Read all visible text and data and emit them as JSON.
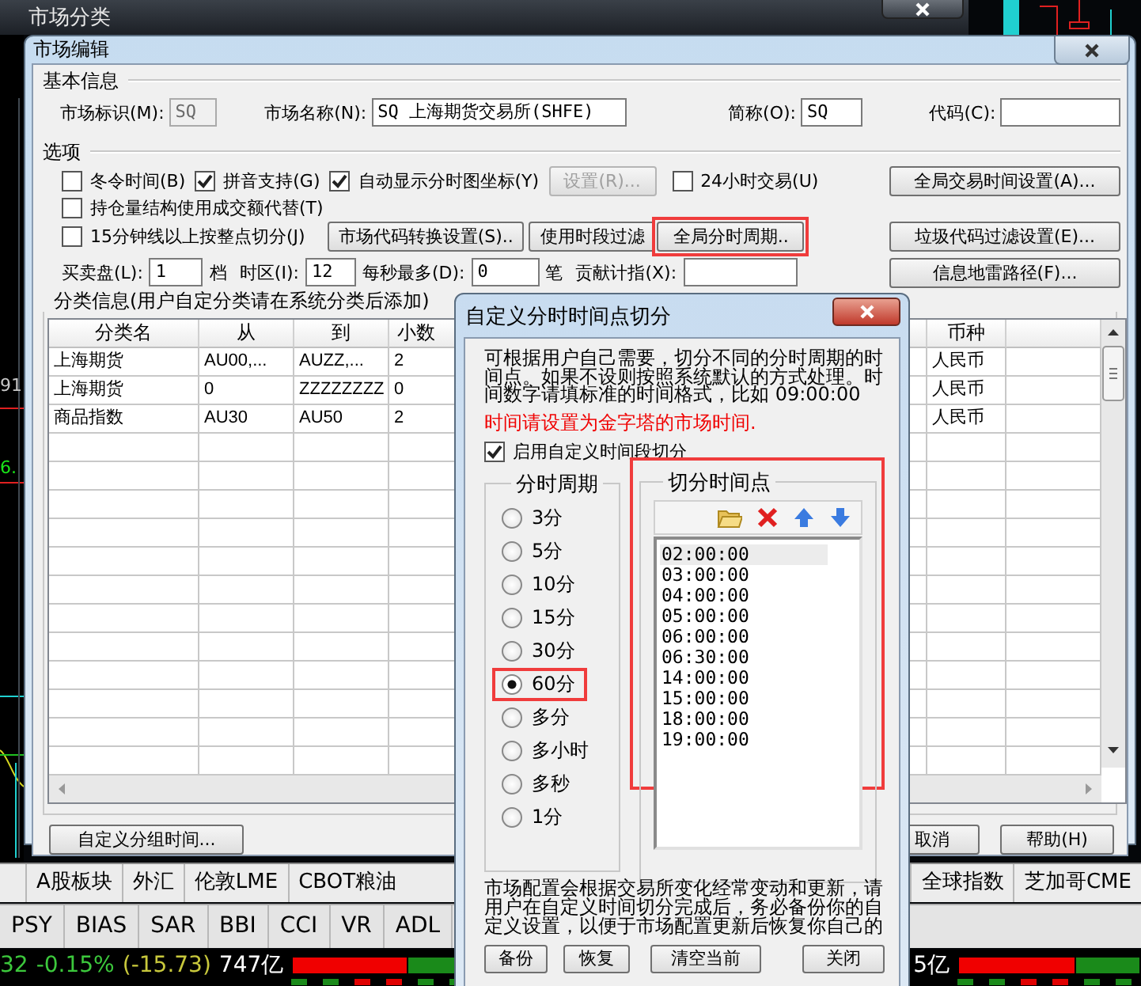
{
  "outer_window": {
    "title": "市场分类"
  },
  "side_chart": {
    "labels": [
      {
        "text": "91",
        "color": "#c8c8c8"
      },
      {
        "text": "6.",
        "color": "#19e619"
      }
    ]
  },
  "market_edit": {
    "title": "市场编辑",
    "basic_info": {
      "title": "基本信息",
      "fields": [
        {
          "label": "市场标识(M):",
          "value": "SQ",
          "disabled": true
        },
        {
          "label": "市场名称(N):",
          "value": "SQ 上海期货交易所(SHFE)",
          "disabled": false
        },
        {
          "label": "简称(O):",
          "value": "SQ",
          "disabled": false
        },
        {
          "label": "代码(C):",
          "disabled": false
        }
      ]
    },
    "options": {
      "title": "选项",
      "rows": [
        {
          "items": [
            {
              "kind": "checkbox",
              "label": "冬令时间(B)",
              "checked": false
            },
            {
              "kind": "checkbox",
              "label": "拼音支持(G)",
              "checked": true
            },
            {
              "kind": "checkbox",
              "label": "自动显示分时图坐标(Y)",
              "checked": true
            },
            {
              "kind": "button",
              "label": "设置(R)...",
              "disabled": true,
              "highlighted": false
            },
            {
              "kind": "checkbox",
              "label": "24小时交易(U)",
              "checked": false
            },
            {
              "kind": "button",
              "label": "全局交易时间设置(A)...",
              "disabled": false,
              "highlighted": false
            }
          ]
        },
        {
          "items": [
            {
              "kind": "checkbox",
              "label": "持仓量结构使用成交额代替(T)",
              "checked": false
            }
          ]
        },
        {
          "items": [
            {
              "kind": "checkbox",
              "label": "15分钟线以上按整点切分(J)",
              "checked": false
            },
            {
              "kind": "button",
              "label": "市场代码转换设置(S)..",
              "disabled": false,
              "highlighted": false
            },
            {
              "kind": "button",
              "label": "使用时段过滤",
              "disabled": false,
              "highlighted": false
            },
            {
              "kind": "button",
              "label": "全局分时周期..",
              "disabled": false,
              "highlighted": true
            },
            {
              "kind": "button",
              "label": "垃圾代码过滤设置(E)...",
              "disabled": false,
              "highlighted": false
            }
          ]
        },
        {
          "items": [
            {
              "kind": "label",
              "text": "买卖盘(L):"
            },
            {
              "kind": "field",
              "value": "1"
            },
            {
              "kind": "label",
              "text": "档"
            },
            {
              "kind": "label",
              "text": "时区(I):"
            },
            {
              "kind": "field",
              "value": "12"
            },
            {
              "kind": "label",
              "text": "每秒最多(D):"
            },
            {
              "kind": "field",
              "value": "0"
            },
            {
              "kind": "label",
              "text": "笔"
            },
            {
              "kind": "label",
              "text": "贡献计指(X):"
            },
            {
              "kind": "field"
            },
            {
              "kind": "button",
              "label": "信息地雷路径(F)...",
              "disabled": false,
              "highlighted": false
            }
          ]
        }
      ]
    },
    "classification": {
      "title": "分类信息(用户自定分类请在系统分类后添加)",
      "columns": [
        "分类名",
        "从",
        "到",
        "小数",
        "币种"
      ],
      "rows": [
        {
          "cells": [
            "上海期货",
            "AU00,...",
            "AUZZ,...",
            "2",
            "人民币"
          ]
        },
        {
          "cells": [
            "上海期货",
            "0",
            "ZZZZZZZZ",
            "0",
            "人民币"
          ]
        },
        {
          "cells": [
            "商品指数",
            "AU30",
            "AU50",
            "2",
            "人民币"
          ]
        }
      ]
    },
    "buttons": [
      "自定义分组时间...",
      "取消",
      "帮助(H)"
    ]
  },
  "time_split_dialog": {
    "title": "自定义分时时间点切分",
    "description": "可根据用户自己需要，切分不同的分时周期的时间点。如果不设则按照系统默认的方式处理。时间数字请填标准的时间格式，比如 09:00:00",
    "warning": "时间请设置为金字塔的市场时间.",
    "enable": {
      "label": "启用自定义时间段切分",
      "checked": true
    },
    "period_group": {
      "title": "分时周期",
      "options": [
        {
          "label": "3分",
          "selected": false,
          "highlighted": false
        },
        {
          "label": "5分",
          "selected": false,
          "highlighted": false
        },
        {
          "label": "10分",
          "selected": false,
          "highlighted": false
        },
        {
          "label": "15分",
          "selected": false,
          "highlighted": false
        },
        {
          "label": "30分",
          "selected": false,
          "highlighted": false
        },
        {
          "label": "60分",
          "selected": true,
          "highlighted": true
        },
        {
          "label": "多分",
          "selected": false,
          "highlighted": false
        },
        {
          "label": "多小时",
          "selected": false,
          "highlighted": false
        },
        {
          "label": "多秒",
          "selected": false,
          "highlighted": false
        },
        {
          "label": "1分",
          "selected": false,
          "highlighted": false
        }
      ]
    },
    "points_group": {
      "title": "切分时间点",
      "highlighted": true,
      "items": [
        {
          "text": "02:00:00",
          "selected": true
        },
        {
          "text": "03:00:00",
          "selected": false
        },
        {
          "text": "04:00:00",
          "selected": false
        },
        {
          "text": "05:00:00",
          "selected": false
        },
        {
          "text": "06:00:00",
          "selected": false
        },
        {
          "text": "06:30:00",
          "selected": false
        },
        {
          "text": "14:00:00",
          "selected": false
        },
        {
          "text": "15:00:00",
          "selected": false
        },
        {
          "text": "18:00:00",
          "selected": false
        },
        {
          "text": "19:00:00",
          "selected": false
        }
      ]
    },
    "note": "市场配置会根据交易所变化经常变动和更新，请用户在自定义时间切分完成后，务必备份你的自定义设置，以便于市场配置更新后恢复你自己的",
    "buttons": [
      "备份",
      "恢复",
      "清空当前",
      "关闭"
    ]
  },
  "background_tabs": {
    "markets": [
      "A股板块",
      "外汇",
      "伦敦LME",
      "CBOT粮油"
    ],
    "markets_right": [
      "全球指数",
      "芝加哥CME"
    ],
    "indicators": [
      "PSY",
      "BIAS",
      "SAR",
      "BBI",
      "CCI",
      "VR",
      "ADL"
    ]
  },
  "quote_bar": {
    "left": [
      {
        "text": "32",
        "color": "#3cc83c"
      },
      {
        "text": "-0.15%",
        "color": "#3cc83c"
      },
      {
        "text": "(-15.73)",
        "color": "#c8c83c"
      },
      {
        "text": "747亿",
        "color": "#ffffff"
      }
    ],
    "left_bar": {
      "level": 0.58
    },
    "right_amount": "5亿",
    "right_bar": {
      "level": 0.65
    }
  }
}
